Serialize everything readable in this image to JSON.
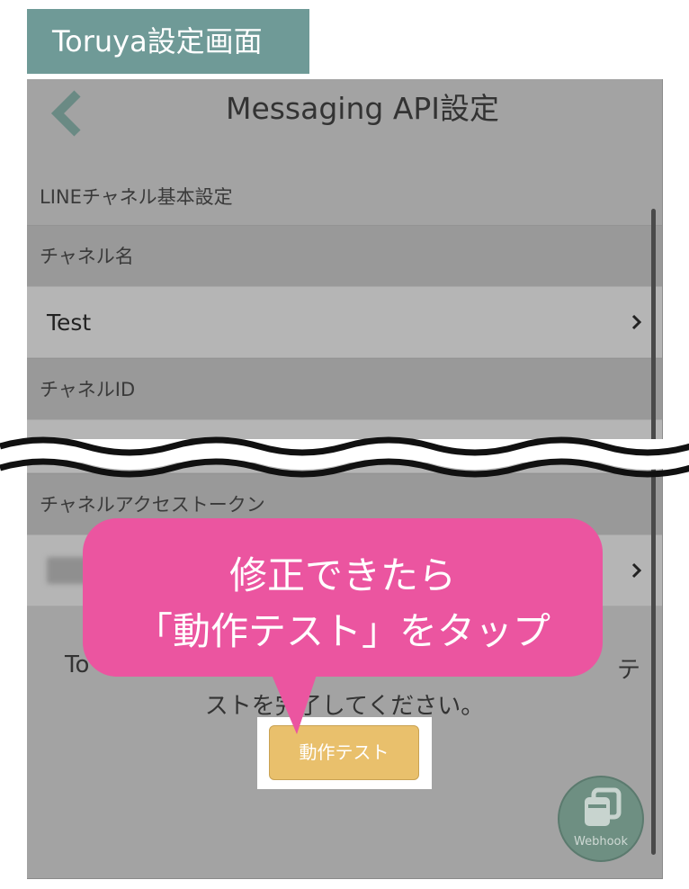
{
  "label_tag": "Toruya設定画面",
  "header": {
    "title": "Messaging API設定"
  },
  "section_title": "LINEチャネル基本設定",
  "rows": {
    "channel_name_label": "チャネル名",
    "channel_name_value": "Test",
    "channel_id_label": "チャネルID",
    "access_token_label": "チャネルアクセストークン"
  },
  "instruction": {
    "line1_start": "To",
    "line1_end": "テ",
    "line2": "ストを完了してください。"
  },
  "test_button_label": "動作テスト",
  "webhook_label": "Webhook",
  "callout": {
    "line1": "修正できたら",
    "line2": "「動作テスト」をタップ"
  },
  "colors": {
    "tag": "#6f9a97",
    "callout": "#eb55a0",
    "button": "#e9c06c",
    "webhook": "#6e8f82"
  }
}
